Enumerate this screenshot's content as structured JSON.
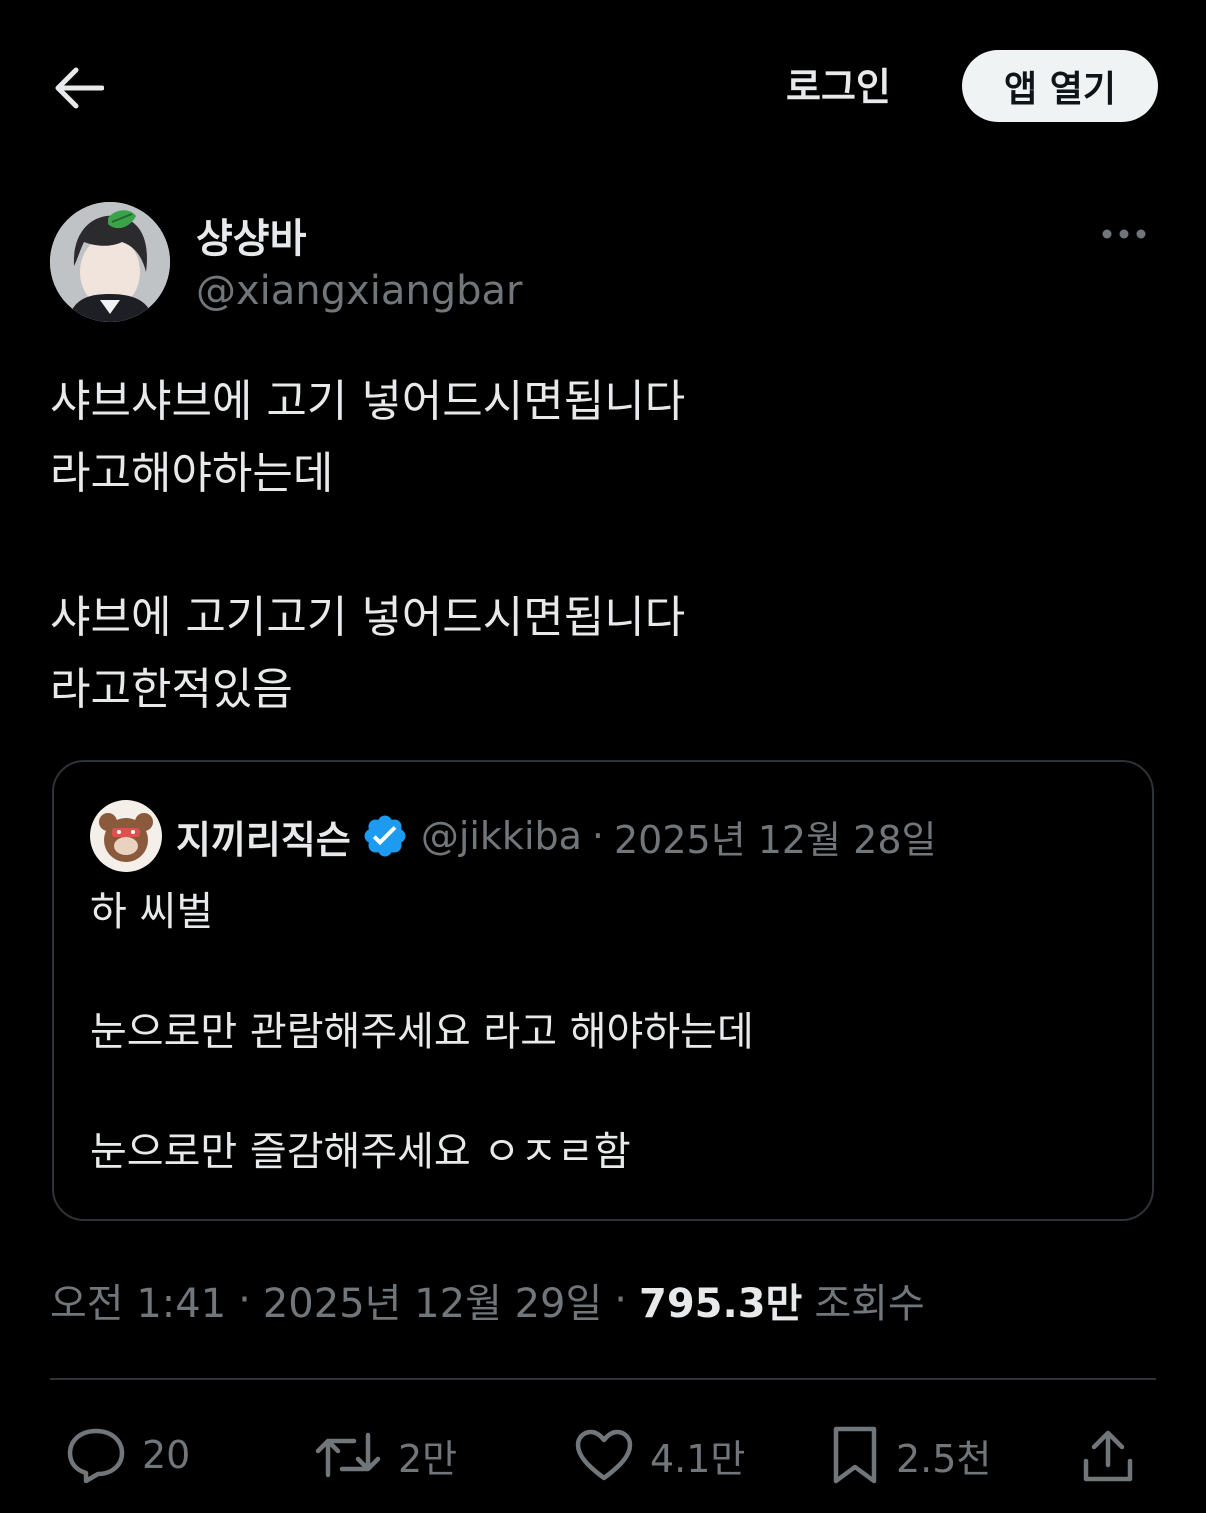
{
  "header": {
    "back_icon": "arrow-left-icon",
    "login_label": "로그인",
    "open_app_label": "앱 열기"
  },
  "author": {
    "name": "샹샹바",
    "handle": "@xiangxiangbar",
    "avatar_icon": "user-avatar",
    "more_icon": "more-horizontal-icon"
  },
  "tweet": {
    "paragraphs": [
      "샤브샤브에 고기 넣어드시면됩니다\n라고해야하는데",
      "샤브에 고기고기 넣어드시면됩니다\n라고한적있음"
    ]
  },
  "quoted_tweet": {
    "name": "지끼리직슨",
    "verified_icon": "verified-badge-icon",
    "handle": "@jikkiba",
    "separator": "·",
    "date": "2025년 12월 28일",
    "paragraphs": [
      "하 씨벌",
      "눈으로만 관람해주세요 라고 해야하는데",
      "눈으로만 즐감해주세요 ㅇㅈㄹ함"
    ]
  },
  "meta": {
    "time": "오전 1:41",
    "separator": "·",
    "date": "2025년 12월 29일",
    "views_count": "795.3만",
    "views_label": "조회수"
  },
  "actions": {
    "reply_count": "20",
    "retweet_count": "2만",
    "like_count": "4.1만",
    "bookmark_count": "2.5천",
    "icons": [
      "reply-icon",
      "retweet-icon",
      "like-icon",
      "bookmark-icon",
      "share-icon"
    ]
  },
  "colors": {
    "background": "#000000",
    "text_primary": "#e7e9ea",
    "text_secondary": "#71767b",
    "border": "#2f3336",
    "verified_blue": "#1d9bf0",
    "button_bg": "#eff3f4"
  }
}
